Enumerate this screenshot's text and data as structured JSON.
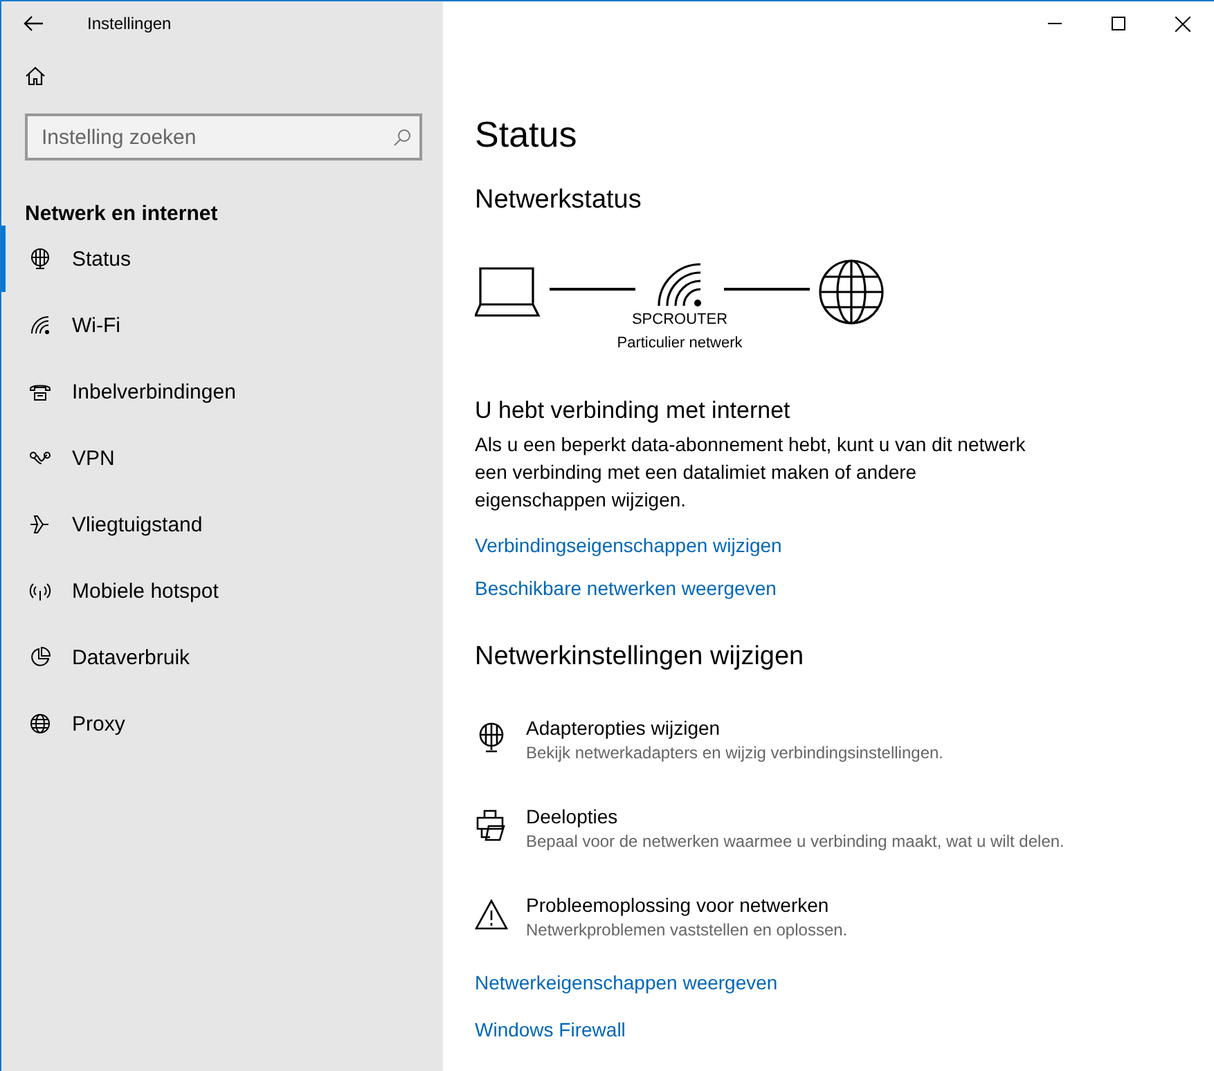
{
  "window": {
    "title": "Instellingen"
  },
  "search": {
    "placeholder": "Instelling zoeken"
  },
  "sidebar": {
    "heading": "Netwerk en internet",
    "items": [
      {
        "label": "Status",
        "selected": true
      },
      {
        "label": "Wi-Fi",
        "selected": false
      },
      {
        "label": "Inbelverbindingen",
        "selected": false
      },
      {
        "label": "VPN",
        "selected": false
      },
      {
        "label": "Vliegtuigstand",
        "selected": false
      },
      {
        "label": "Mobiele hotspot",
        "selected": false
      },
      {
        "label": "Dataverbruik",
        "selected": false
      },
      {
        "label": "Proxy",
        "selected": false
      }
    ]
  },
  "page": {
    "title": "Status",
    "section": "Netwerkstatus",
    "network": {
      "name": "SPCROUTER",
      "type": "Particulier netwerk"
    },
    "status_heading": "U hebt verbinding met internet",
    "status_text": "Als u een beperkt data-abonnement hebt, kunt u van dit netwerk een verbinding met een datalimiet maken of andere eigenschappen wijzigen.",
    "links": [
      "Verbindingseigenschappen wijzigen",
      "Beschikbare netwerken weergeven"
    ],
    "settings_heading": "Netwerkinstellingen wijzigen",
    "options": [
      {
        "title": "Adapteropties wijzigen",
        "description": "Bekijk netwerkadapters en wijzig verbindingsinstellingen."
      },
      {
        "title": "Deelopties",
        "description": "Bepaal voor de netwerken waarmee u verbinding maakt, wat u wilt delen."
      },
      {
        "title": "Probleemoplossing voor netwerken",
        "description": "Netwerkproblemen vaststellen en oplossen."
      }
    ],
    "bottom_links": [
      "Netwerkeigenschappen weergeven",
      "Windows Firewall"
    ]
  }
}
